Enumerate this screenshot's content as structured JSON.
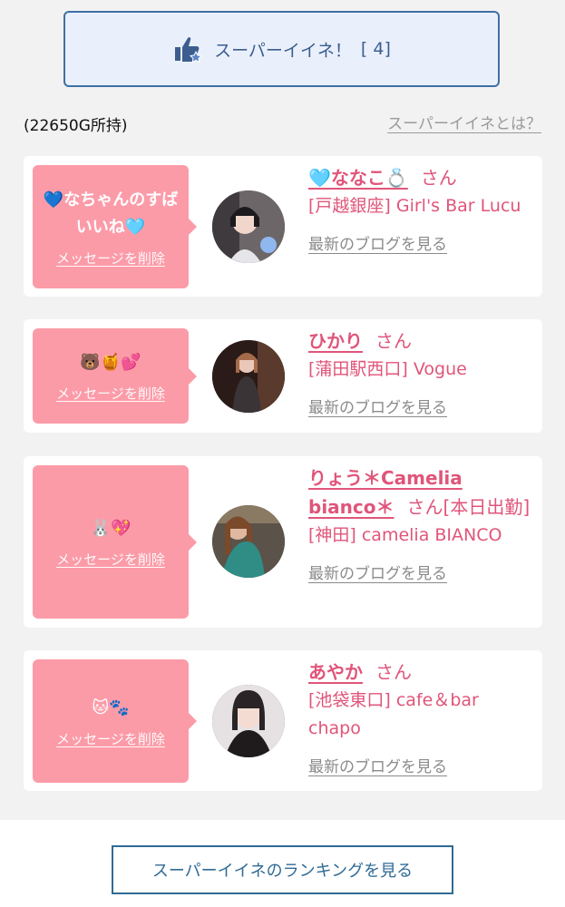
{
  "header": {
    "super_like_label": "スーパーイイネ！",
    "super_like_count": "[ 4]",
    "gold_text": "(22650G所持)",
    "about_link": "スーパーイイネとは？"
  },
  "delete_label": "メッセージを削除",
  "blog_label": "最新のブログを見る",
  "san_label": "さん",
  "cards": [
    {
      "message": "💙なちゃんのすばいいね🩵",
      "name": "🩵ななこ💍",
      "extra": "",
      "shop": "[戸越銀座] Girl's Bar Lucu"
    },
    {
      "message": "🐻🍯💕",
      "name": "ひかり",
      "extra": "",
      "shop": "[蒲田駅西口] Vogue"
    },
    {
      "message": "🐰💖",
      "name": "りょう＊Camelia bianco＊",
      "extra": "[本日出勤]",
      "shop": "[神田] camelia BIANCO"
    },
    {
      "message": "🐱🐾",
      "name": "あやか",
      "extra": "",
      "shop": "[池袋東口] cafe＆bar chapo"
    }
  ],
  "footer": {
    "ranking_button": "スーパーイイネのランキングを見る"
  },
  "colors": {
    "accent_pink": "#fc9ba8",
    "name_pink": "#e0557a",
    "button_blue": "#3f6fa6"
  }
}
